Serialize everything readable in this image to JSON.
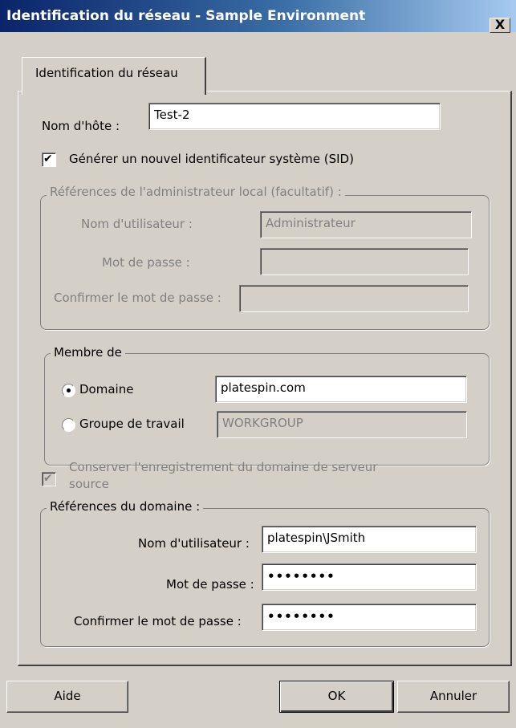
{
  "window": {
    "title": "Identification du réseau - Sample Environment",
    "close_glyph": "X"
  },
  "tab": {
    "label": "Identification du réseau"
  },
  "hostname": {
    "label": "Nom d'hôte :",
    "value": "Test-2"
  },
  "generate_sid": {
    "label": "Générer un nouvel identificateur système (SID)",
    "checked": true
  },
  "local_admin": {
    "legend": "Références de l'administrateur local (facultatif) :",
    "username_label": "Nom d'utilisateur :",
    "username_value": "Administrateur",
    "password_label": "Mot de passe :",
    "confirm_label": "Confirmer le mot de passe :"
  },
  "member_of": {
    "legend": "Membre de",
    "domain_label": "Domaine",
    "domain_value": "platespin.com",
    "domain_selected": true,
    "workgroup_label": "Groupe de travail",
    "workgroup_value": "WORKGROUP"
  },
  "preserve_domain": {
    "label_line1": "Conserver l'enregistrement du domaine de serveur",
    "label_line2": "source",
    "checked": true
  },
  "domain_credentials": {
    "legend": "Références du domaine :",
    "username_label": "Nom d'utilisateur :",
    "username_value": "platespin\\JSmith",
    "password_label": "Mot de passe :",
    "password_value": "••••••••",
    "confirm_label": "Confirmer le mot de passe :",
    "confirm_value": "••••••••"
  },
  "buttons": {
    "help": "Aide",
    "ok": "OK",
    "cancel": "Annuler"
  },
  "check_glyph": "✔"
}
